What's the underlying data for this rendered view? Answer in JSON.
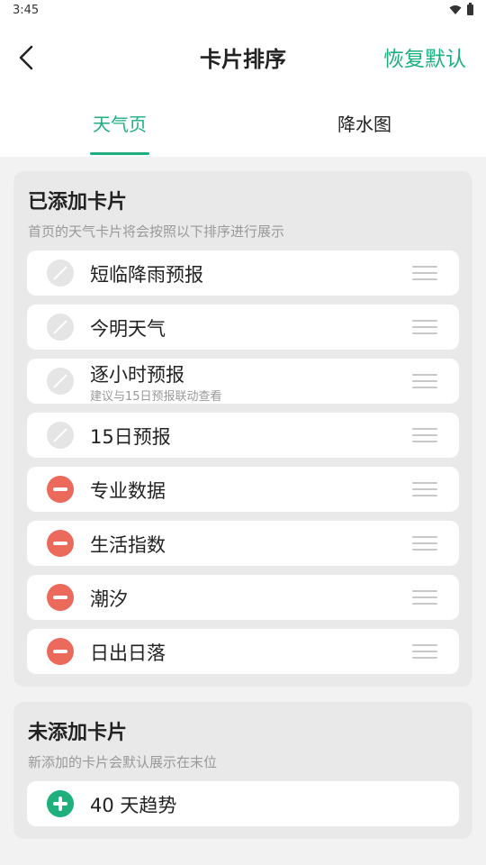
{
  "status_bar": {
    "time": "3:45",
    "icons": [
      "wifi-icon",
      "battery-icon"
    ]
  },
  "header": {
    "title": "卡片排序",
    "back_icon": "chevron-left-icon",
    "reset_label": "恢复默认"
  },
  "tabs": [
    {
      "label": "天气页",
      "active": true
    },
    {
      "label": "降水图",
      "active": false
    }
  ],
  "colors": {
    "accent": "#1db07d",
    "remove": "#ec6a5c",
    "disabled": "#e5e5e5"
  },
  "added_section": {
    "title": "已添加卡片",
    "description": "首页的天气卡片将会按照以下排序进行展示",
    "items": [
      {
        "label": "短临降雨预报",
        "state": "disabled"
      },
      {
        "label": "今明天气",
        "state": "disabled"
      },
      {
        "label": "逐小时预报",
        "subtitle": "建议与15日预报联动查看",
        "state": "disabled"
      },
      {
        "label": "15日预报",
        "state": "disabled"
      },
      {
        "label": "专业数据",
        "state": "removable"
      },
      {
        "label": "生活指数",
        "state": "removable"
      },
      {
        "label": "潮汐",
        "state": "removable"
      },
      {
        "label": "日出日落",
        "state": "removable"
      }
    ]
  },
  "not_added_section": {
    "title": "未添加卡片",
    "description": "新添加的卡片会默认展示在末位",
    "items": [
      {
        "label": "40 天趋势",
        "state": "addable"
      }
    ]
  }
}
